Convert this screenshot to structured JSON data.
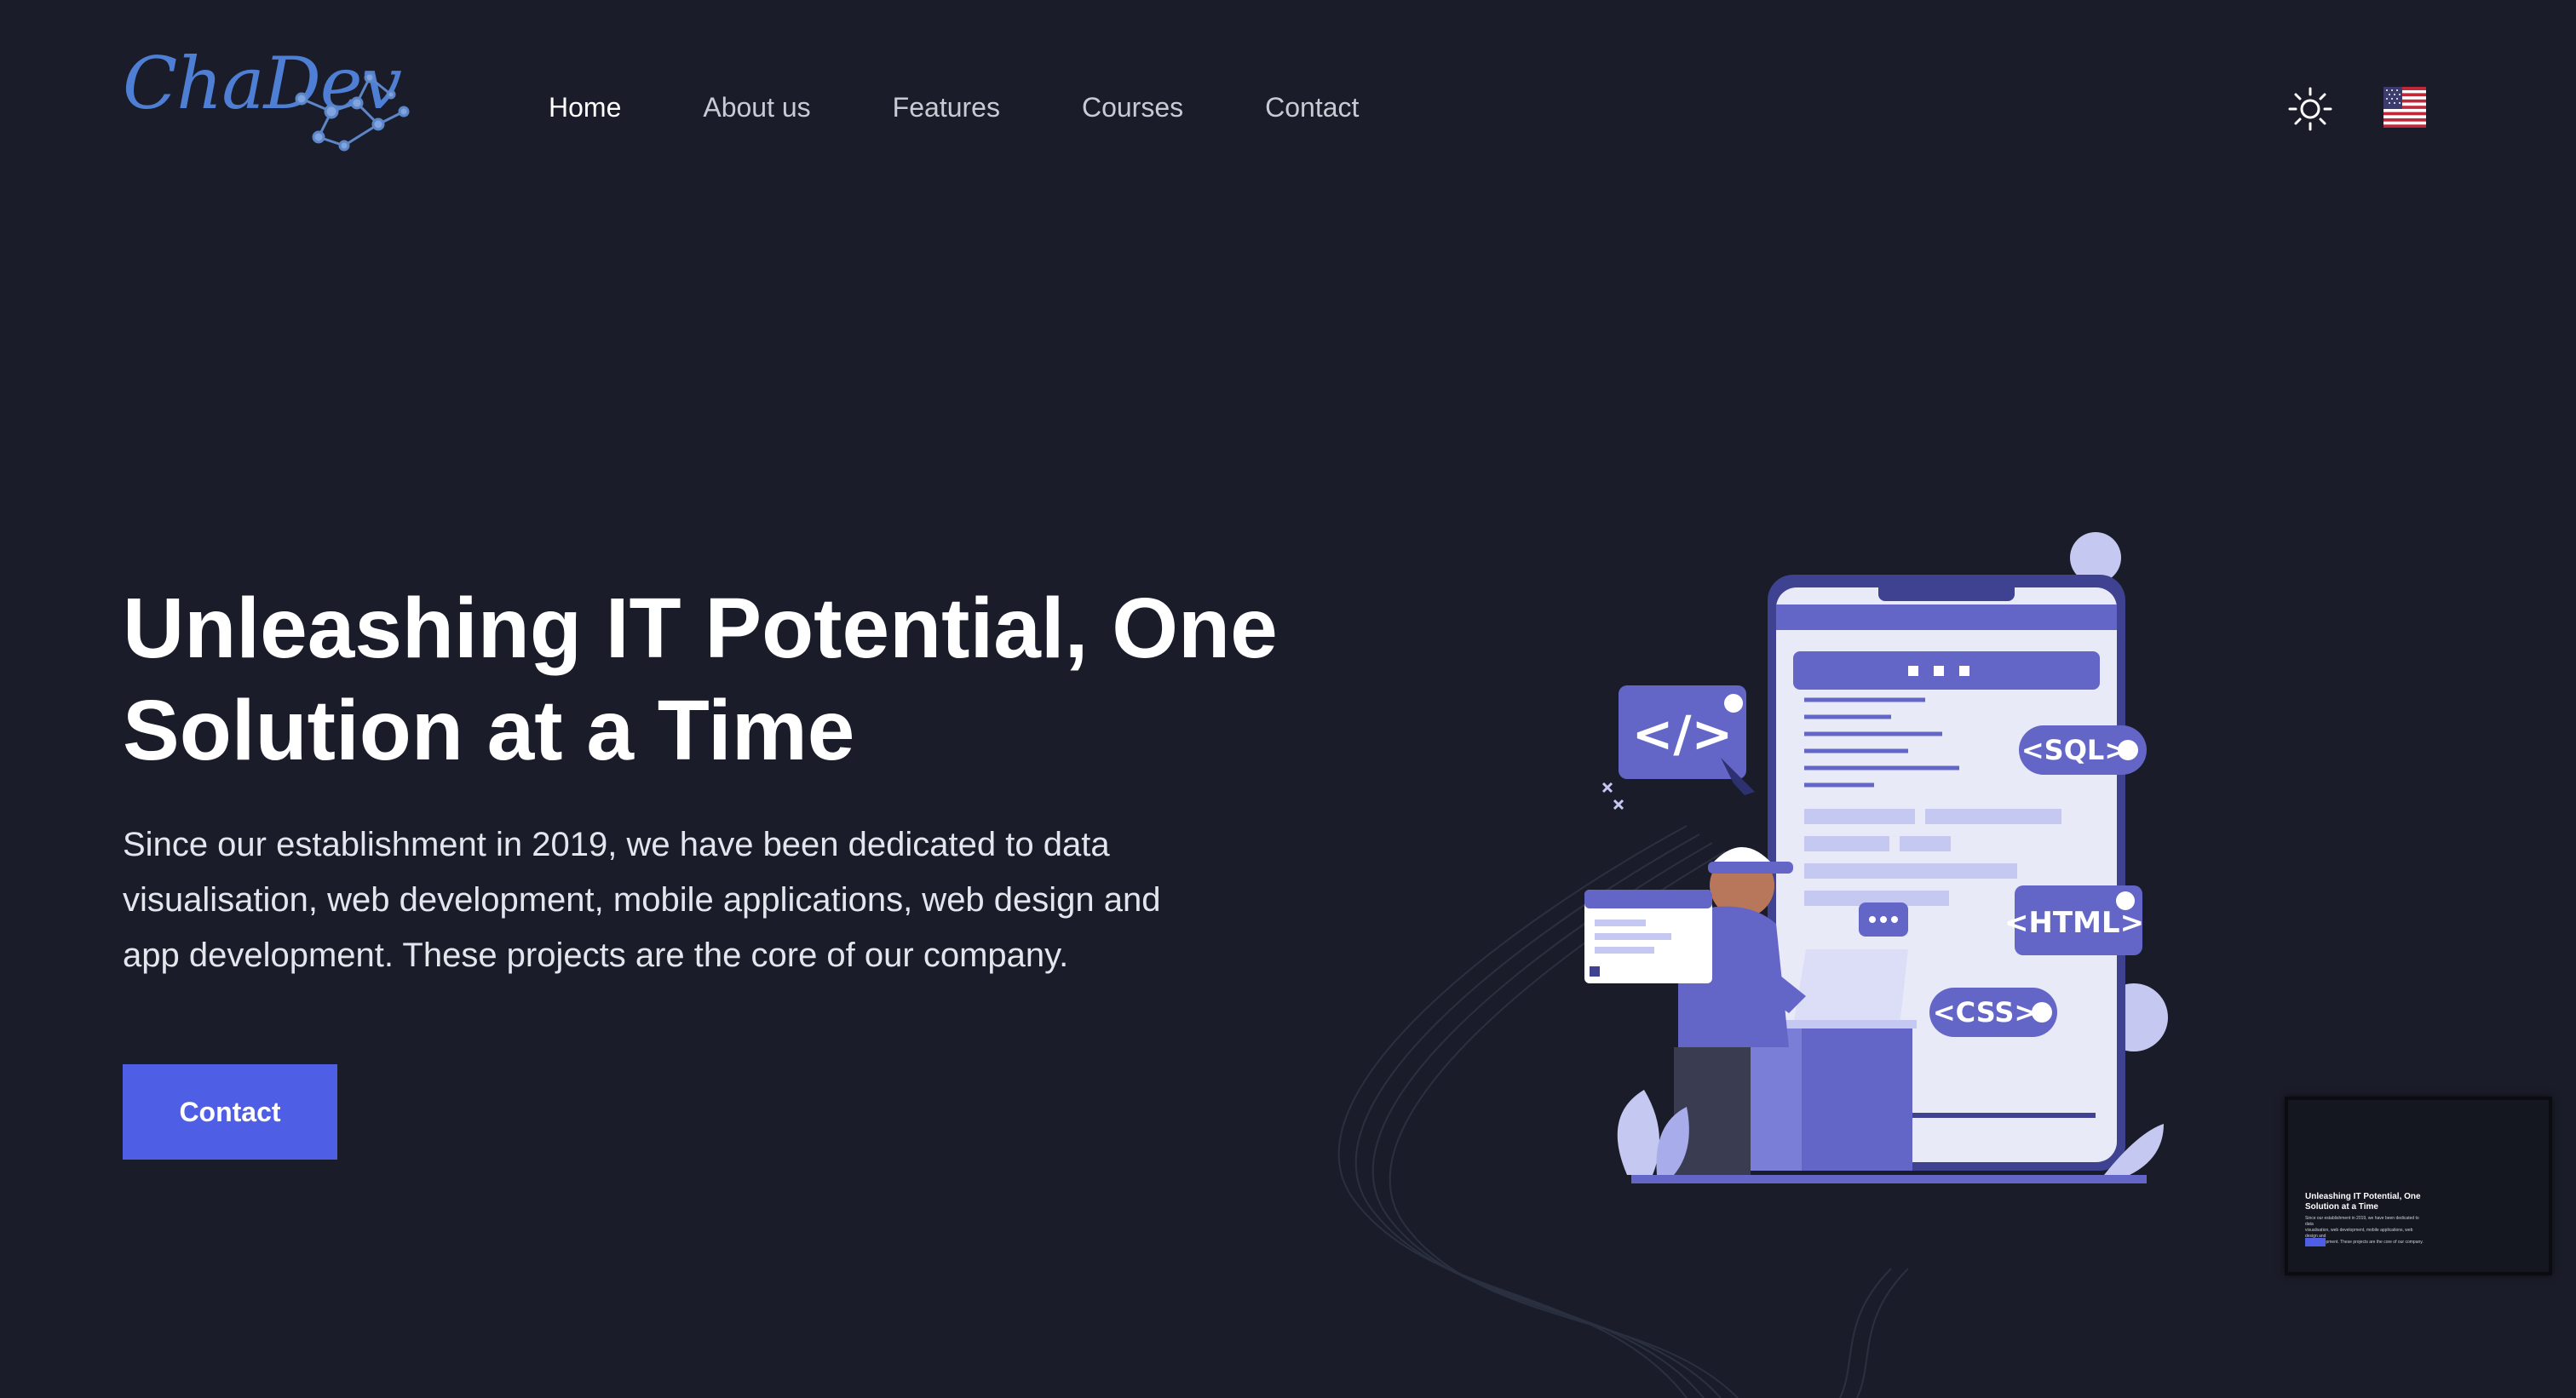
{
  "brand": {
    "logo_text": "ChaDev"
  },
  "nav": {
    "items": [
      {
        "label": "Home",
        "active": true
      },
      {
        "label": "About us",
        "active": false
      },
      {
        "label": "Features",
        "active": false
      },
      {
        "label": "Courses",
        "active": false
      },
      {
        "label": "Contact",
        "active": false
      }
    ]
  },
  "header_controls": {
    "theme_icon": "sun-icon",
    "language_icon": "us-flag-icon"
  },
  "hero": {
    "title_line1": "Unleashing IT Potential, One",
    "title_line2": "Solution at a Time",
    "text_line1": "Since our establishment in 2019, we have been dedicated to data",
    "text_line2": "visualisation, web development, mobile applications, web design and",
    "text_line3": "app development. These projects are the core of our company.",
    "button_label": "Contact"
  },
  "illustration": {
    "tags": [
      "</>",
      "<SQL>",
      "<HTML>",
      "<CSS>"
    ]
  },
  "colors": {
    "background": "#1a1d29",
    "accent": "#4e5fe6",
    "illustration_primary": "#6366c7",
    "illustration_light": "#c5c8f0"
  }
}
